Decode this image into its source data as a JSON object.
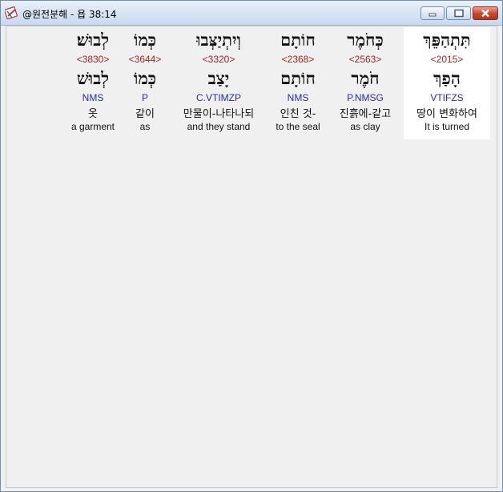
{
  "window": {
    "title": "@원전분해 - 욥 38:14",
    "app_icon": "bible-analysis-app-icon",
    "buttons": {
      "minimize": "minimize-icon",
      "maximize": "maximize-icon",
      "close": "close-icon"
    },
    "colors": {
      "strong": "#a02424",
      "morph": "#2a2aa8",
      "selected_bg": "#ffffff"
    }
  },
  "words": [
    {
      "hebrew": "לְבוּשׁ׃",
      "strong": "<3830>",
      "lemma": "לְבוּשׁ",
      "morph": "NMS",
      "korean": "옷",
      "english": "a garment",
      "selected": false
    },
    {
      "hebrew": "כְּמוֹ",
      "strong": "<3644>",
      "lemma": "כְּמוֹ",
      "morph": "P",
      "korean": "같이",
      "english": "as",
      "selected": false
    },
    {
      "hebrew": "וְיִתְיַצְּבוּ",
      "strong": "<3320>",
      "lemma": "יָצַב",
      "morph": "C.VTIMZP",
      "korean": "만물이-나타나되",
      "english": "and they stand",
      "selected": false
    },
    {
      "hebrew": "חוֹתָם",
      "strong": "<2368>",
      "lemma": "חוֹתָם",
      "morph": "NMS",
      "korean": "인친 것-",
      "english": "to the seal",
      "selected": false
    },
    {
      "hebrew": "כְּחֹמֶר",
      "strong": "<2563>",
      "lemma": "חֹמֶר",
      "morph": "P.NMSG",
      "korean": "진흙에-같고",
      "english": "as clay",
      "selected": false
    },
    {
      "hebrew": "תִּתְהַפֵּךְ",
      "strong": "<2015>",
      "lemma": "הָפַךְ",
      "morph": "VTIFZS",
      "korean": "땅이 변화하여",
      "english": "It is turned",
      "selected": true
    }
  ]
}
